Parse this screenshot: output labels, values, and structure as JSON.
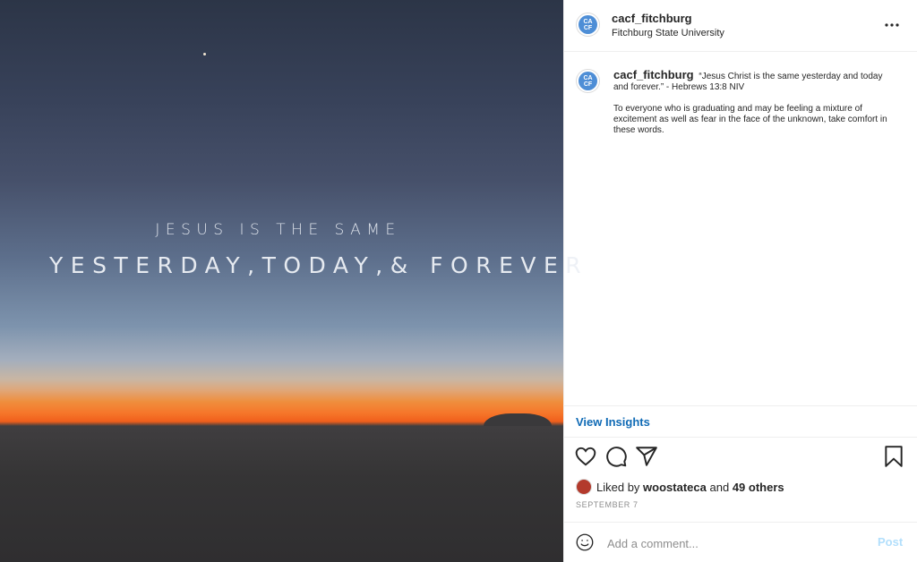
{
  "media": {
    "overlay_line1": "JESUS IS THE SAME",
    "overlay_line2": "YESTERDAY,TODAY,& FOREVER"
  },
  "header": {
    "avatar_text": [
      "CA",
      "CF"
    ],
    "username": "cacf_fitchburg",
    "location": "Fitchburg State University",
    "more_icon": "more-horizontal-icon"
  },
  "caption": {
    "username": "cacf_fitchburg",
    "paragraph1": "“Jesus Christ is the same yesterday and today and forever.” - Hebrews 13:8 NIV",
    "paragraph2": "To everyone who is graduating and may be feeling a mixture of excitement as well as fear in the face of the unknown, take comfort in these words."
  },
  "insights": {
    "label": "View Insights"
  },
  "actions": {
    "like_icon": "heart-icon",
    "comment_icon": "comment-icon",
    "share_icon": "paper-plane-icon",
    "save_icon": "bookmark-icon"
  },
  "likes": {
    "prefix": "Liked by",
    "first_user": "woostateca",
    "joiner": "and",
    "others": "49 others"
  },
  "date": "SEPTEMBER 7",
  "comment": {
    "placeholder": "Add a comment...",
    "post_label": "Post"
  },
  "colors": {
    "link_blue": "#0f6ab5",
    "post_disabled": "#b2dffc",
    "border": "#efefef",
    "avatar_blue": "#4e8ed6"
  }
}
